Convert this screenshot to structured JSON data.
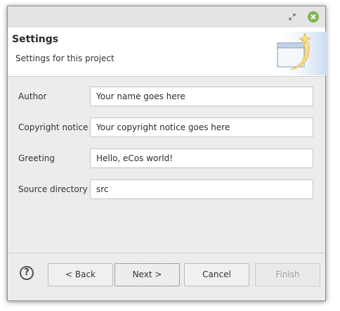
{
  "header": {
    "title": "Settings",
    "subtitle": "Settings for this project"
  },
  "form": {
    "fields": [
      {
        "label": "Author",
        "value": "Your name goes here"
      },
      {
        "label": "Copyright notice",
        "value": "Your copyright notice goes here"
      },
      {
        "label": "Greeting",
        "value": "Hello, eCos world!"
      },
      {
        "label": "Source directory",
        "value": "src"
      }
    ]
  },
  "footer": {
    "help_icon": "?",
    "back_label": "< Back",
    "next_label": "Next >",
    "cancel_label": "Cancel",
    "finish_label": "Finish",
    "finish_enabled": false
  },
  "titlebar": {
    "icons": [
      "restore-icon",
      "close-icon"
    ]
  },
  "colors": {
    "close_button": "#7fb34f",
    "header_background": "#ffffff",
    "dialog_background": "#ececec"
  }
}
